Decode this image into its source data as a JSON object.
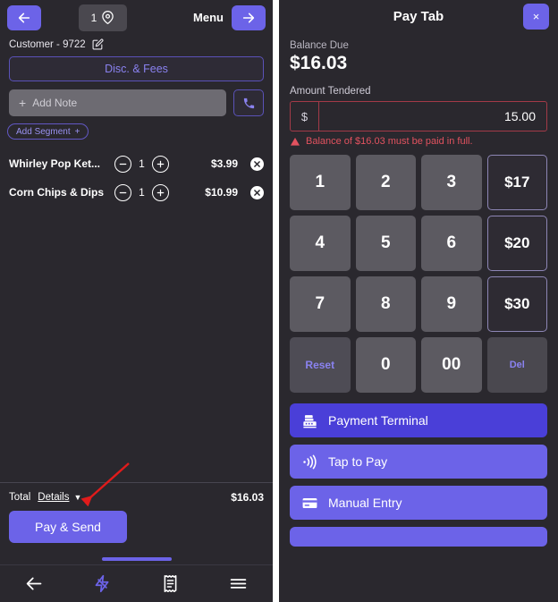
{
  "colors": {
    "accent": "#6c63e8",
    "accent_dark": "#4a3fd8",
    "panel_bg": "#2a282e",
    "key_bg": "#5c5a61",
    "error": "#e2525f",
    "muted_purple": "#8a82f0"
  },
  "left": {
    "topbar": {
      "back_icon": "arrow-left-icon",
      "forward_icon": "arrow-right-icon",
      "table_count": "1",
      "pin_icon": "map-pin-icon",
      "menu_label": "Menu"
    },
    "customer": {
      "name": "Customer - 9722",
      "edit_icon": "edit-pencil-icon"
    },
    "disc_fees_label": "Disc. & Fees",
    "note": {
      "placeholder": "Add Note",
      "plus": "+",
      "phone_icon": "phone-icon"
    },
    "add_segment_label": "Add Segment",
    "add_segment_plus": "+",
    "items": [
      {
        "name": "Whirley Pop Ket...",
        "qty": "1",
        "price": "$3.99",
        "minus_icon": "minus-circle-icon",
        "plus_icon": "plus-circle-icon",
        "remove_icon": "close-circle-icon"
      },
      {
        "name": "Corn Chips & Dips",
        "qty": "1",
        "price": "$10.99",
        "minus_icon": "minus-circle-icon",
        "plus_icon": "plus-circle-icon",
        "remove_icon": "close-circle-icon"
      }
    ],
    "totals": {
      "total_label": "Total",
      "details_label": "Details",
      "caret": "▼",
      "amount": "$16.03"
    },
    "pay_send_label": "Pay & Send",
    "bottom_nav": [
      {
        "icon": "arrow-left-icon",
        "active": false
      },
      {
        "icon": "lightning-bolt-icon",
        "active": true
      },
      {
        "icon": "receipt-icon",
        "active": false
      },
      {
        "icon": "hamburger-menu-icon",
        "active": false
      }
    ]
  },
  "right": {
    "title": "Pay Tab",
    "close_label": "×",
    "balance_due_label": "Balance Due",
    "balance_due_amount": "$16.03",
    "amount_tendered_label": "Amount Tendered",
    "currency_prefix": "$",
    "amount_tendered_value": "15.00",
    "error_message": "Balance of $16.03 must be paid in full.",
    "keypad": [
      {
        "label": "1",
        "kind": "digit"
      },
      {
        "label": "2",
        "kind": "digit"
      },
      {
        "label": "3",
        "kind": "digit"
      },
      {
        "label": "$17",
        "kind": "quick"
      },
      {
        "label": "4",
        "kind": "digit"
      },
      {
        "label": "5",
        "kind": "digit"
      },
      {
        "label": "6",
        "kind": "digit"
      },
      {
        "label": "$20",
        "kind": "quick"
      },
      {
        "label": "7",
        "kind": "digit"
      },
      {
        "label": "8",
        "kind": "digit"
      },
      {
        "label": "9",
        "kind": "digit"
      },
      {
        "label": "$30",
        "kind": "quick"
      },
      {
        "label": "Reset",
        "kind": "action"
      },
      {
        "label": "0",
        "kind": "digit"
      },
      {
        "label": "00",
        "kind": "digit"
      },
      {
        "label": "Del",
        "kind": "del"
      }
    ],
    "payment_methods": [
      {
        "label": "Payment Terminal",
        "icon": "cash-register-icon",
        "style": "dark"
      },
      {
        "label": "Tap to Pay",
        "icon": "contactless-pay-icon",
        "style": "light"
      },
      {
        "label": "Manual Entry",
        "icon": "credit-card-icon",
        "style": "light"
      },
      {
        "label": "",
        "icon": "",
        "style": "cut"
      }
    ]
  }
}
